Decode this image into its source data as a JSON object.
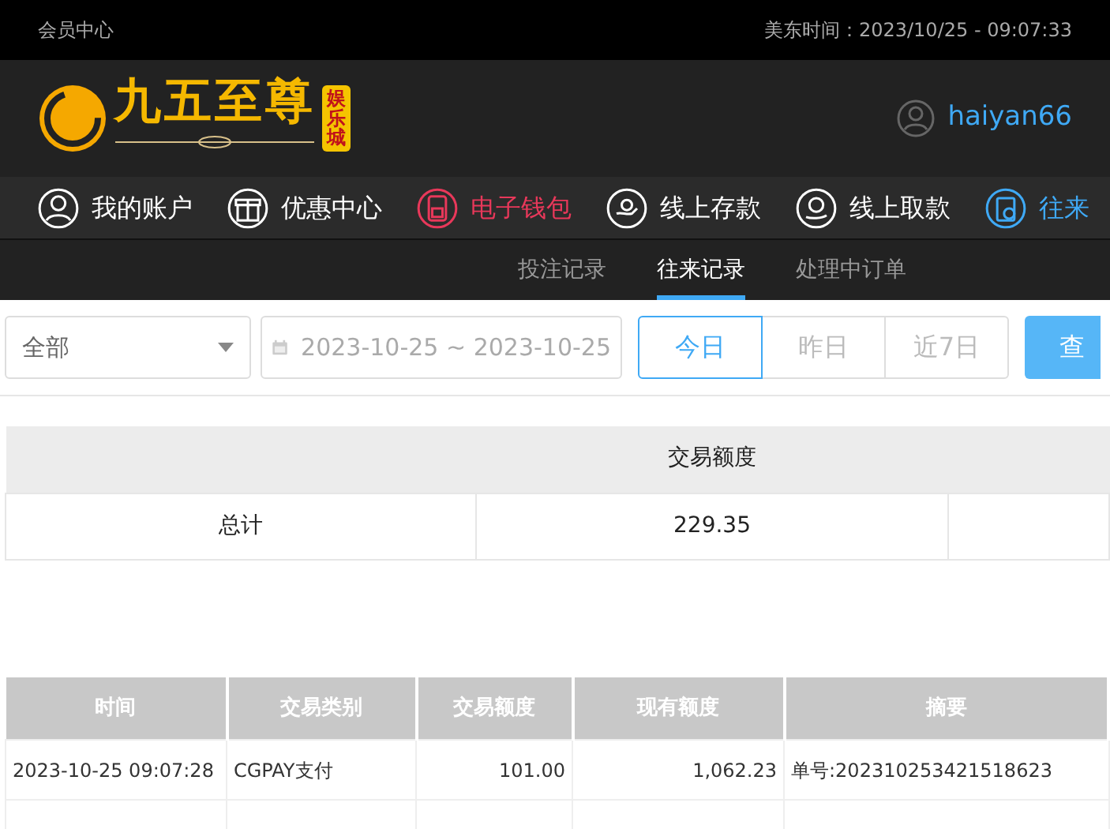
{
  "top_bar": {
    "title": "会员中心",
    "clock": "美东时间：2023/10/25 - 09:07:33"
  },
  "header": {
    "logo_text": "九五至尊",
    "logo_badge": "娱乐城",
    "username": "haiyan66"
  },
  "nav": [
    {
      "label": "我的账户",
      "color": "#ffffff"
    },
    {
      "label": "优惠中心",
      "color": "#ffffff"
    },
    {
      "label": "电子钱包",
      "color": "#e8385a"
    },
    {
      "label": "线上存款",
      "color": "#ffffff"
    },
    {
      "label": "线上取款",
      "color": "#ffffff"
    },
    {
      "label": "往来",
      "color": "#3fa9f5"
    }
  ],
  "sub_tabs": [
    {
      "label": "投注记录",
      "selected": false
    },
    {
      "label": "往来记录",
      "selected": true
    },
    {
      "label": "处理中订单",
      "selected": false
    }
  ],
  "filter": {
    "type_select": "全部",
    "date_range": "2023-10-25 ~ 2023-10-25",
    "quick_ranges": [
      {
        "label": "今日",
        "selected": true
      },
      {
        "label": "昨日",
        "selected": false
      },
      {
        "label": "近7日",
        "selected": false
      }
    ],
    "search_button": "查"
  },
  "summary": {
    "header": "交易额度",
    "rows": [
      [
        "总计",
        "229.35"
      ]
    ]
  },
  "table": {
    "columns": [
      "时间",
      "交易类别",
      "交易额度",
      "现有额度",
      "摘要"
    ],
    "rows": [
      [
        "2023-10-25 09:07:28",
        "CGPAY支付",
        "101.00",
        "1,062.23",
        "单号:202310253421518623"
      ]
    ]
  }
}
